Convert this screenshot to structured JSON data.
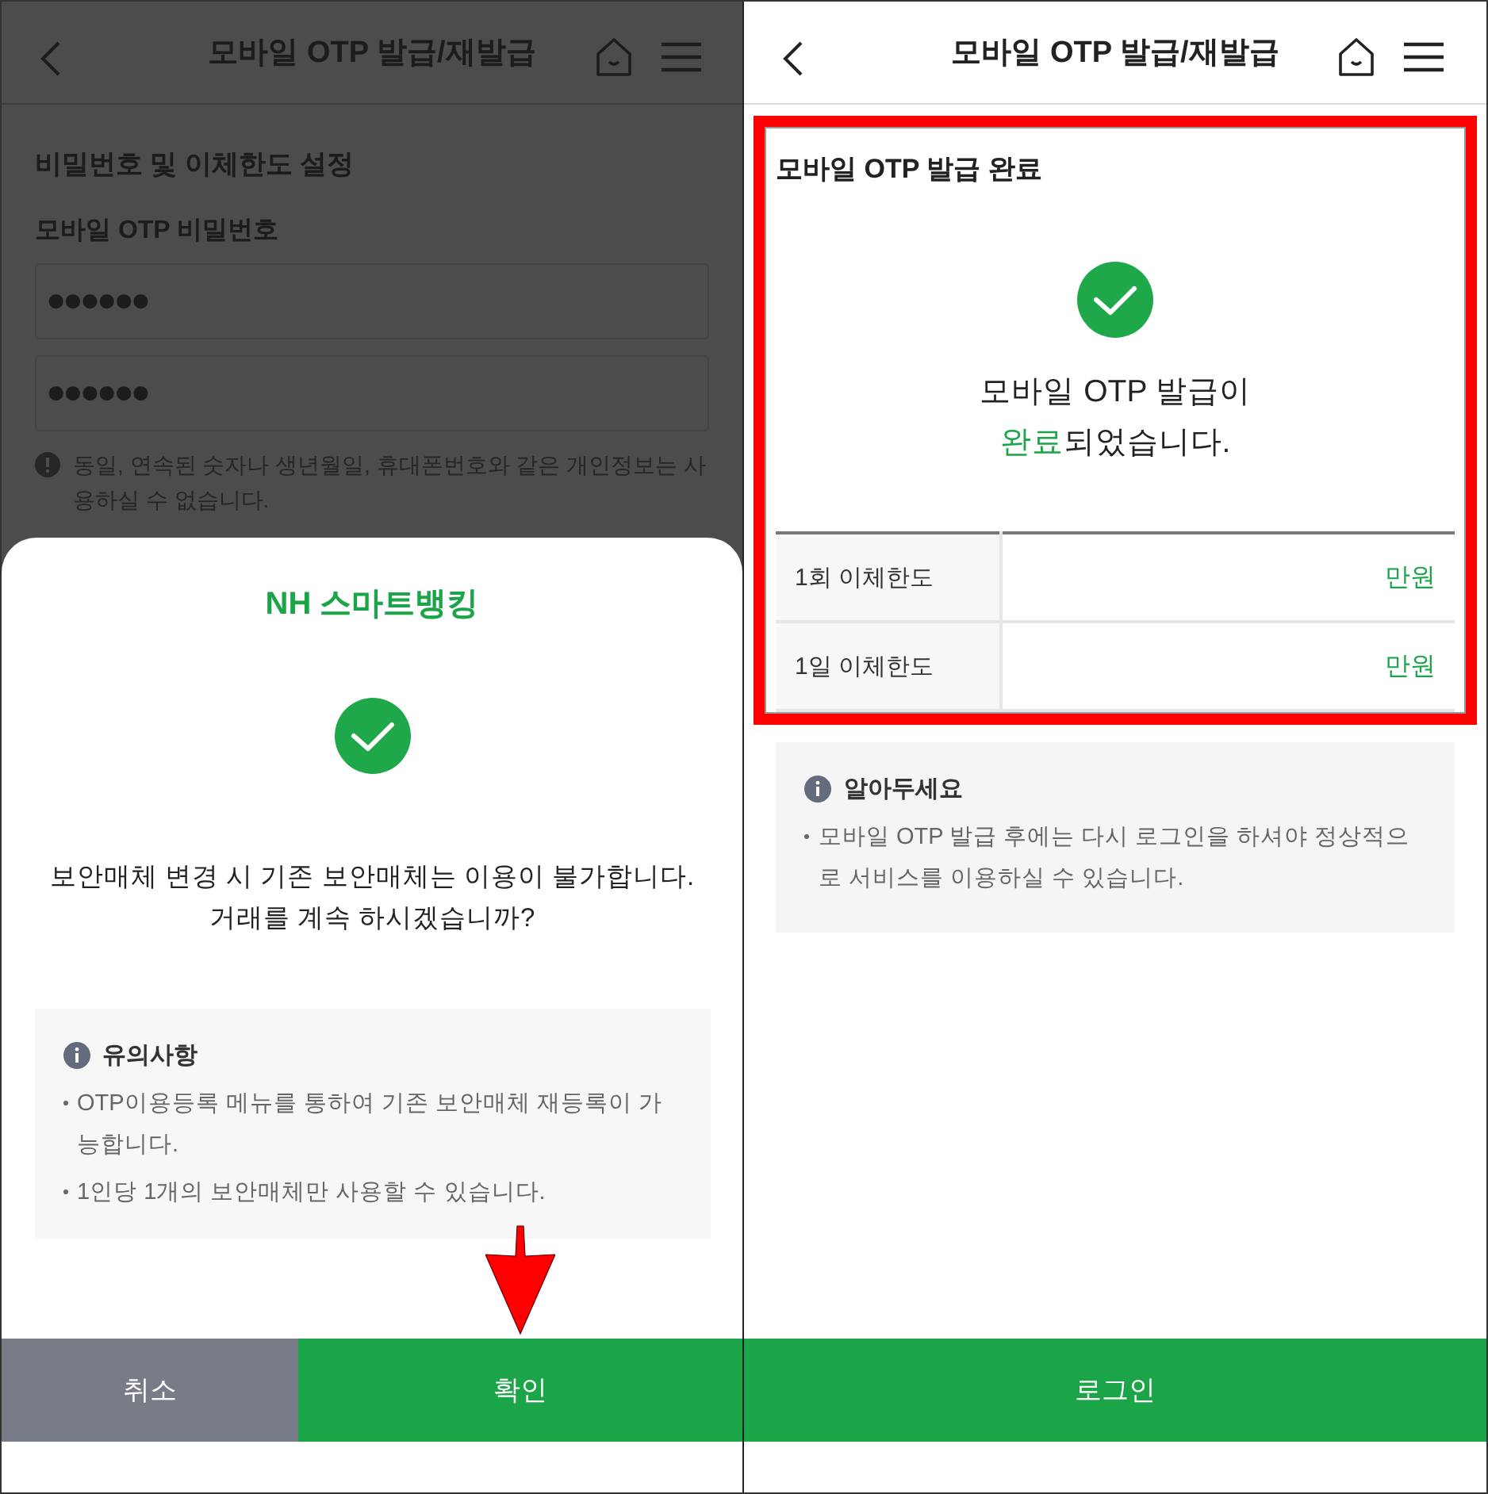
{
  "left_screen": {
    "header": {
      "title": "모바일 OTP 발급/재발급"
    },
    "section_title": "비밀번호 및 이체한도 설정",
    "password_label": "모바일 OTP 비밀번호",
    "password_fields": [
      {
        "value": "●●●●●●"
      },
      {
        "value": "●●●●●●"
      }
    ],
    "warning": "동일, 연속된 숫자나 생년월일, 휴대폰번호와 같은 개인정보는 사용하실 수 없습니다.",
    "dialog": {
      "logo": "**NH** 스마트뱅킹",
      "message_lines": [
        "보안매체 변경 시 기존 보안매체는 이용이 불가합니다.",
        "거래를 계속 하시겠습니까?"
      ],
      "notice": {
        "title": "유의사항",
        "items": [
          "OTP이용등록 메뉴를 통하여 기존 보안매체 재등록이 가능합니다.",
          "1인당 1개의 보안매체만 사용할 수 있습니다."
        ]
      },
      "buttons": [
        {
          "label": "취소",
          "kind": "secondary",
          "marked": false
        },
        {
          "label": "확인",
          "kind": "primary",
          "marked": true
        }
      ]
    }
  },
  "right_screen": {
    "header": {
      "title": "모바일 OTP 발급/재발급"
    },
    "result": {
      "highlighted": true,
      "title": "모바일 OTP 발급 완료",
      "message": {
        "line1": "모바일 OTP 발급이",
        "highlight": "완료",
        "rest": "되었습니다."
      },
      "limits": [
        {
          "label": "1회 이체한도",
          "value": "만원"
        },
        {
          "label": "1일 이체한도",
          "value": "만원"
        }
      ]
    },
    "notice": {
      "title": "알아두세요",
      "items": [
        "모바일 OTP 발급 후에는 다시 로그인을 하셔야 정상적으로 서비스를 이용하실 수 있습니다."
      ]
    },
    "button": {
      "label": "로그인"
    }
  }
}
